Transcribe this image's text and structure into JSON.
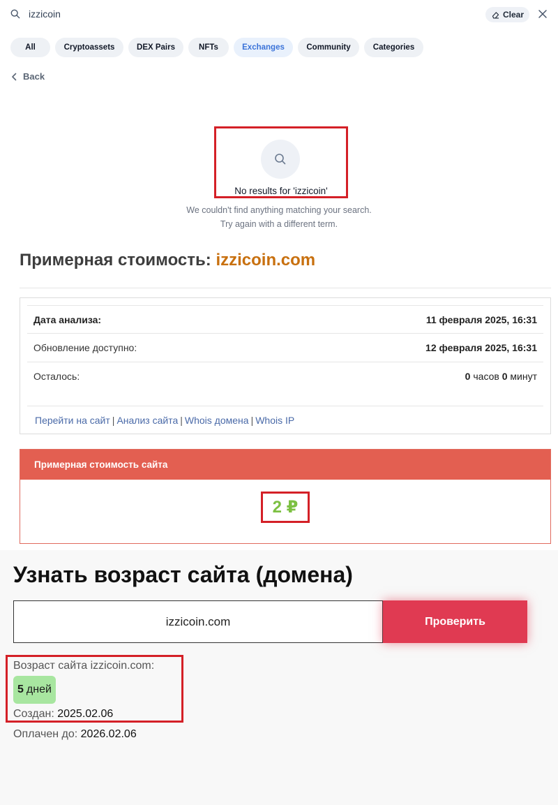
{
  "search": {
    "query": "izzicoin",
    "clear_label": "Clear"
  },
  "filters": [
    {
      "label": "All",
      "active": false
    },
    {
      "label": "Cryptoassets",
      "active": false
    },
    {
      "label": "DEX Pairs",
      "active": false
    },
    {
      "label": "NFTs",
      "active": false
    },
    {
      "label": "Exchanges",
      "active": true
    },
    {
      "label": "Community",
      "active": false
    },
    {
      "label": "Categories",
      "active": false
    }
  ],
  "back_label": "Back",
  "no_results": {
    "title": "No results for 'izzicoin'",
    "line1": "We couldn't find anything matching your search.",
    "line2": "Try again with a different term."
  },
  "cost": {
    "heading_prefix": "Примерная стоимость:",
    "domain": "izzicoin.com",
    "rows": [
      {
        "label": "Дата анализа:",
        "value": "11 февраля 2025, 16:31"
      },
      {
        "label": "Обновление доступно:",
        "value": "12 февраля 2025, 16:31"
      }
    ],
    "remaining": {
      "label": "Осталось:",
      "hours": "0",
      "hours_unit": "часов",
      "minutes": "0",
      "minutes_unit": "минут"
    },
    "links": [
      "Перейти на сайт",
      "Анализ сайта",
      "Whois домена",
      "Whois IP"
    ],
    "link_separator": "|",
    "price_header": "Примерная стоимость сайта",
    "price_value": "2 ₽"
  },
  "age": {
    "title": "Узнать возраст сайта (домена)",
    "input_value": "izzicoin.com",
    "button_label": "Проверить",
    "result_label": "Возраст сайта izzicoin.com:",
    "age_number": "5",
    "age_unit": "дней",
    "created_label": "Создан:",
    "created_value": "2025.02.06",
    "paid_label": "Оплачен до:",
    "paid_value": "2026.02.06"
  },
  "colors": {
    "accent_active_chip": "#3b73d9",
    "domain_highlight": "#c8700f",
    "price_header_bg": "#e35f51",
    "price_value": "#7cc042",
    "check_button": "#e03a52",
    "age_badge": "#a8e6a0",
    "annotation_red": "#d42027"
  }
}
